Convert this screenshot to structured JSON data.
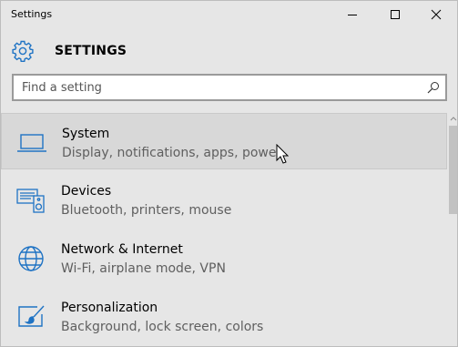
{
  "window": {
    "title": "Settings",
    "controls": [
      "minimize-icon",
      "maximize-icon",
      "close-icon"
    ]
  },
  "header": {
    "icon": "gear-icon",
    "title": "SETTINGS"
  },
  "search": {
    "placeholder": "Find a setting",
    "value": "",
    "icon": "search-icon"
  },
  "categories": [
    {
      "label": "System",
      "description": "Display, notifications, apps, power",
      "icon": "laptop-icon",
      "selected": true
    },
    {
      "label": "Devices",
      "description": "Bluetooth, printers, mouse",
      "icon": "devices-icon",
      "selected": false
    },
    {
      "label": "Network & Internet",
      "description": "Wi-Fi, airplane mode, VPN",
      "icon": "globe-icon",
      "selected": false
    },
    {
      "label": "Personalization",
      "description": "Background, lock screen, colors",
      "icon": "paint-icon",
      "selected": false
    }
  ],
  "colors": {
    "accent": "#1f73c4",
    "background": "#e6e6e6",
    "selected_row": "#d8d8d8"
  }
}
